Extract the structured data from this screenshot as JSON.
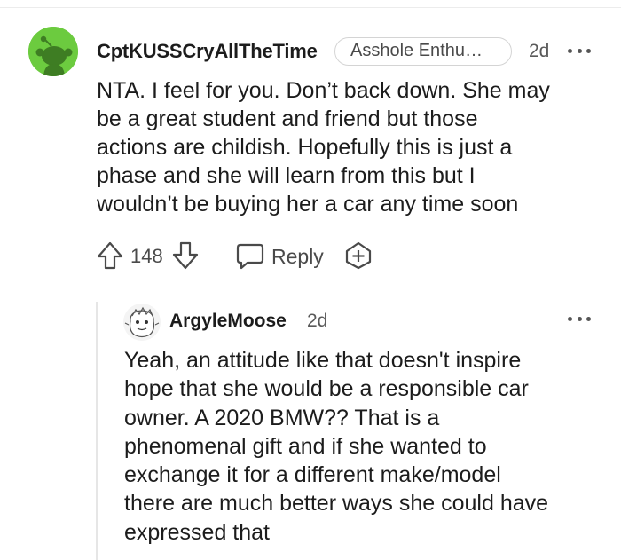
{
  "comment": {
    "username": "CptKUSSCryAllTheTime",
    "flair": "Asshole Enthu…",
    "time": "2d",
    "body_lines": [
      "NTA. I feel for you. Don’t back down. She may",
      "be a great student and friend but those",
      "actions are childish. Hopefully this is just a",
      "phase and she will learn from this but I",
      "wouldn’t be buying her a car any time soon"
    ],
    "vote_count": "148",
    "reply_label": "Reply",
    "icons": {
      "avatar": "snoo-avatar",
      "upvote": "upvote-arrow-icon",
      "downvote": "downvote-arrow-icon",
      "reply": "speech-bubble-icon",
      "award": "award-plus-icon",
      "more": "more-options-icon"
    }
  },
  "reply": {
    "username": "ArgyleMoose",
    "time": "2d",
    "body_lines": [
      "Yeah, an attitude like that doesn't inspire",
      "hope that she would be a responsible car",
      "owner. A 2020 BMW?? That is a",
      "phenomenal gift and if she wanted to",
      "exchange it for a different make/model",
      "there are much better ways she could have",
      "expressed that"
    ],
    "icons": {
      "avatar": "sketch-avatar",
      "more": "more-options-icon"
    }
  },
  "colors": {
    "avatar_green": "#6ccb3f",
    "text": "#1c1c1c",
    "muted": "#5a5a5a"
  }
}
